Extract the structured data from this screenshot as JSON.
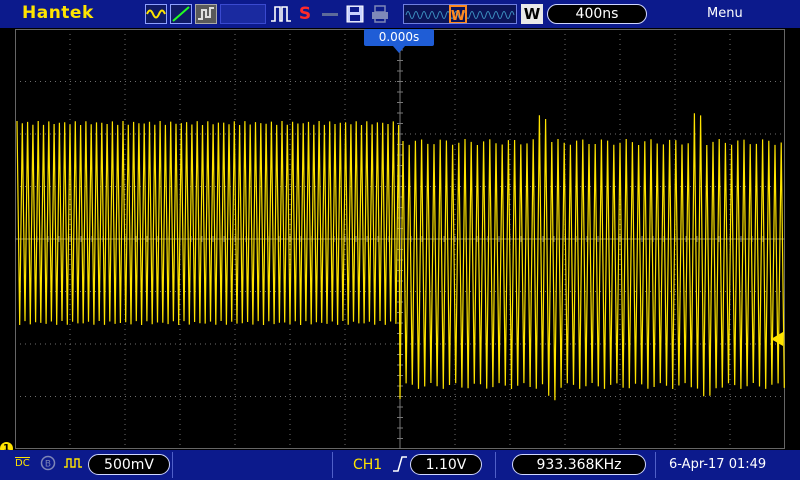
{
  "brand": "Hantek",
  "toolbar": {
    "icons": [
      "sine-wave-icon",
      "ramp-icon",
      "arbitrary-icon",
      "blank-slot",
      "pulse-icon",
      "save-setup-icon",
      "disk-save-icon",
      "print-icon"
    ],
    "s_label": "S",
    "w_badge": "W",
    "timebase": "400ns",
    "menu_label": "Menu"
  },
  "plot": {
    "trigger_position": "0.000s"
  },
  "channel": {
    "marker": "1",
    "coupling": "DC",
    "volts_div": "500mV"
  },
  "trigger": {
    "source": "CH1",
    "slope": "rising",
    "level": "1.10V"
  },
  "measure": {
    "frequency": "933.368KHz"
  },
  "datetime": "6-Apr-17 01:49",
  "colors": {
    "trace": "#ffe400",
    "bar": "#0c1a8c",
    "accent": "#1f5dd6",
    "trigger_s": "#ff2a2a"
  }
}
